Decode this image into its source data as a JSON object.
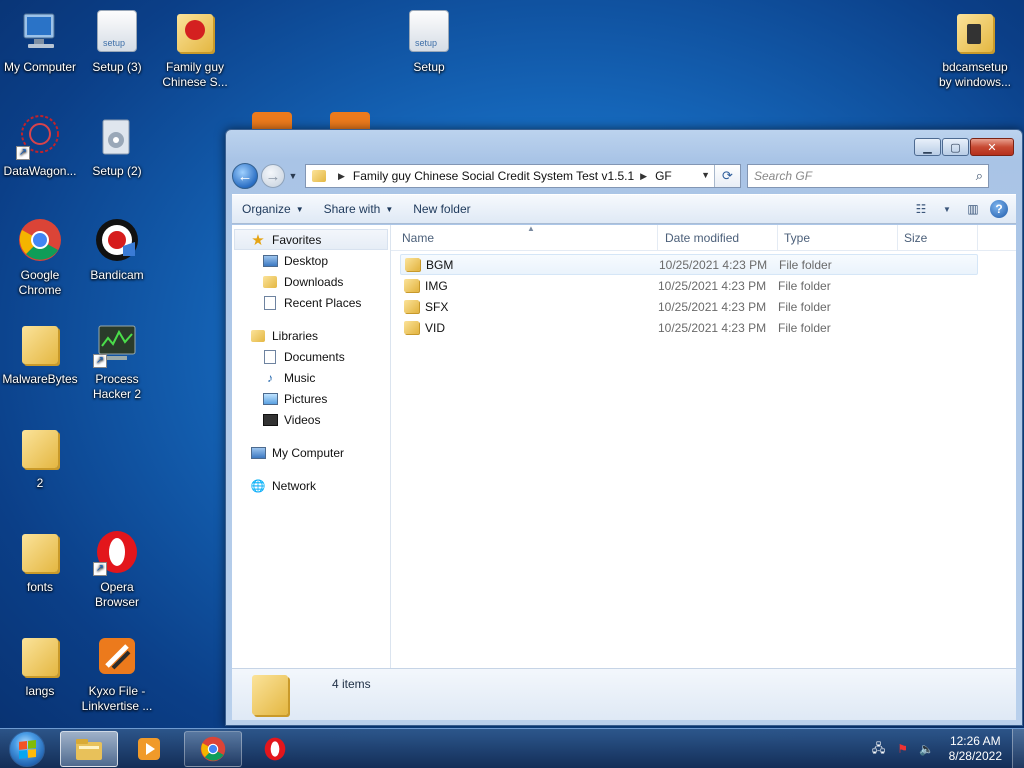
{
  "desktop": {
    "icons": [
      {
        "label": "My Computer",
        "icon": "computer-icon"
      },
      {
        "label": "Setup (3)",
        "icon": "setup-icon"
      },
      {
        "label": "Family guy Chinese S...",
        "icon": "folder-icon"
      },
      {
        "label": "Setup",
        "icon": "setup-icon"
      },
      {
        "label": "bdcamsetup by windows...",
        "icon": "folder-icon"
      },
      {
        "label": "DataWagon...",
        "icon": "datawagon-icon"
      },
      {
        "label": "Setup (2)",
        "icon": "setup-icon"
      },
      {
        "label": "Google Chrome",
        "icon": "chrome-icon"
      },
      {
        "label": "Bandicam",
        "icon": "bandicam-icon"
      },
      {
        "label": "MalwareBytes",
        "icon": "folder-icon"
      },
      {
        "label": "Process Hacker 2",
        "icon": "process-hacker-icon"
      },
      {
        "label": "2",
        "icon": "folder-icon"
      },
      {
        "label": "fonts",
        "icon": "folder-icon"
      },
      {
        "label": "Opera Browser",
        "icon": "opera-icon"
      },
      {
        "label": "langs",
        "icon": "folder-icon"
      },
      {
        "label": "Kyxo File - Linkvertise ...",
        "icon": "kyxo-icon"
      }
    ]
  },
  "explorer": {
    "address": {
      "segments": [
        "Family guy Chinese Social Credit System Test v1.5.1",
        "GF"
      ]
    },
    "search": {
      "placeholder": "Search GF"
    },
    "toolbar": {
      "organize": "Organize",
      "share_with": "Share with",
      "new_folder": "New folder"
    },
    "nav_pane": {
      "favorites": {
        "label": "Favorites",
        "items": [
          "Desktop",
          "Downloads",
          "Recent Places"
        ]
      },
      "libraries": {
        "label": "Libraries",
        "items": [
          "Documents",
          "Music",
          "Pictures",
          "Videos"
        ]
      },
      "computer": "My Computer",
      "network": "Network"
    },
    "columns": {
      "name": "Name",
      "date": "Date modified",
      "type": "Type",
      "size": "Size"
    },
    "files": [
      {
        "name": "BGM",
        "date": "10/25/2021 4:23 PM",
        "type": "File folder"
      },
      {
        "name": "IMG",
        "date": "10/25/2021 4:23 PM",
        "type": "File folder"
      },
      {
        "name": "SFX",
        "date": "10/25/2021 4:23 PM",
        "type": "File folder"
      },
      {
        "name": "VID",
        "date": "10/25/2021 4:23 PM",
        "type": "File folder"
      }
    ],
    "details": {
      "count": "4 items"
    }
  },
  "taskbar": {
    "apps": [
      "explorer-icon",
      "media-player-icon",
      "chrome-icon",
      "opera-icon"
    ],
    "clock": {
      "time": "12:26 AM",
      "date": "8/28/2022"
    }
  },
  "colors": {
    "accent": "#1d59a8",
    "selection": "#eaf3fc"
  }
}
